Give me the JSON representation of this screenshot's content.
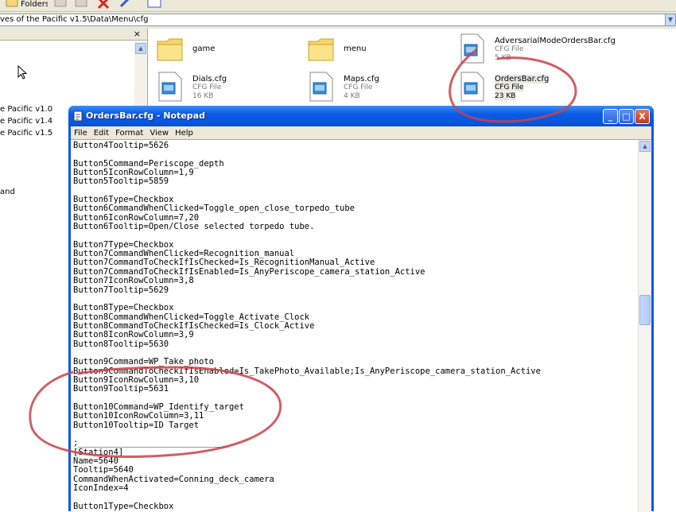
{
  "explorer": {
    "address_path": "ves of the Pacific v1.5\\Data\\Menu\\cfg",
    "toolbar_folders_label": "Folders",
    "left_pane": {
      "close_label": "×",
      "items": [
        "e Pacific v1.0",
        "e Pacific v1.4",
        "e Pacific v1.5",
        "and"
      ]
    },
    "files": [
      {
        "name": "game",
        "kind": "folder"
      },
      {
        "name": "menu",
        "kind": "folder"
      },
      {
        "name": "AdversarialModeOrdersBar.cfg",
        "type": "CFG File",
        "size": "5 KB"
      },
      {
        "name": "Dials.cfg",
        "type": "CFG File",
        "size": "16 KB"
      },
      {
        "name": "Maps.cfg",
        "type": "CFG File",
        "size": "4 KB"
      },
      {
        "name": "OrdersBar.cfg",
        "type": "CFG File",
        "size": "23 KB"
      }
    ]
  },
  "notepad": {
    "title": "OrdersBar.cfg - Notepad",
    "menu": [
      "File",
      "Edit",
      "Format",
      "View",
      "Help"
    ],
    "buttons": {
      "minimize": "_",
      "maximize": "□",
      "close": "X"
    },
    "content": "Button4Tooltip=5626\n\nButton5Command=Periscope_depth\nButton5IconRowColumn=1,9\nButton5Tooltip=5859\n\nButton6Type=Checkbox\nButton6CommandWhenClicked=Toggle_open_close_torpedo_tube\nButton6IconRowColumn=7,20\nButton6Tooltip=Open/Close selected torpedo tube.\n\nButton7Type=Checkbox\nButton7CommandWhenClicked=Recognition_manual\nButton7CommandToCheckIfIsChecked=Is_RecognitionManual_Active\nButton7CommandToCheckIfIsEnabled=Is_AnyPeriscope_camera_station_Active\nButton7IconRowColumn=3,8\nButton7Tooltip=5629\n\nButton8Type=Checkbox\nButton8CommandWhenClicked=Toggle_Activate_Clock\nButton8CommandToCheckIfIsChecked=Is_Clock_Active\nButton8IconRowColumn=3,9\nButton8Tooltip=5630\n\nButton9Command=WP_Take_photo\nButton9CommandToCheckIfIsEnabled=Is_TakePhoto_Available;Is_AnyPeriscope_camera_station_Active\nButton9IconRowColumn=3,10\nButton9Tooltip=5631\n\nButton10Command=WP_Identify_target\nButton10IconRowColumn=3,11\nButton10Tooltip=ID Target\n\n;______________________________\n[Station4]\nName=5640\nTooltip=5640\nCommandWhenActivated=Conning_deck_camera\nIconIndex=4\n\nButton1Type=Checkbox"
  },
  "colors": {
    "xp_titlebar": "#0b5ae6",
    "xp_face": "#ece9d8",
    "annotation_red": "#c8434a"
  }
}
